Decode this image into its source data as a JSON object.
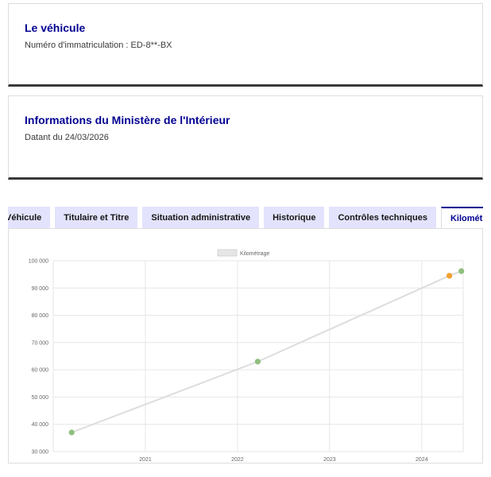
{
  "vehicle": {
    "title": "Le véhicule",
    "registration": "Numéro d'immatriculation : ED-8**-BX"
  },
  "ministry": {
    "title": "Informations du Ministère de l'Intérieur",
    "date": "Datant du 24/03/2026"
  },
  "tabs": [
    {
      "label": "Véhicule",
      "active": false
    },
    {
      "label": "Titulaire et Titre",
      "active": false
    },
    {
      "label": "Situation administrative",
      "active": false
    },
    {
      "label": "Historique",
      "active": false
    },
    {
      "label": "Contrôles techniques",
      "active": false
    },
    {
      "label": "Kilométrage",
      "active": true
    }
  ],
  "colors": {
    "accent": "#000091",
    "tab_bg": "#e3e3fd",
    "point_green": "#8fbf7f",
    "point_orange": "#f0a030",
    "line": "#dddddd"
  },
  "chart_data": {
    "type": "line",
    "legend": "Kilométrage",
    "legend_position": "top-center",
    "grid": true,
    "x_ticks": [
      "2021",
      "2022",
      "2023",
      "2024"
    ],
    "y_ticks": [
      "30 000",
      "40 000",
      "50 000",
      "60 000",
      "70 000",
      "80 000",
      "90 000",
      "100 000"
    ],
    "ylim": [
      30000,
      100000
    ],
    "xlim": [
      2020.0,
      2024.45
    ],
    "series": [
      {
        "name": "Kilométrage",
        "points": [
          {
            "x": 2020.2,
            "y": 37000,
            "color": "#8fbf7f"
          },
          {
            "x": 2022.22,
            "y": 63000,
            "color": "#8fbf7f"
          },
          {
            "x": 2024.3,
            "y": 94500,
            "color": "#f0a030"
          },
          {
            "x": 2024.43,
            "y": 96200,
            "color": "#8fbf7f"
          }
        ]
      }
    ]
  }
}
